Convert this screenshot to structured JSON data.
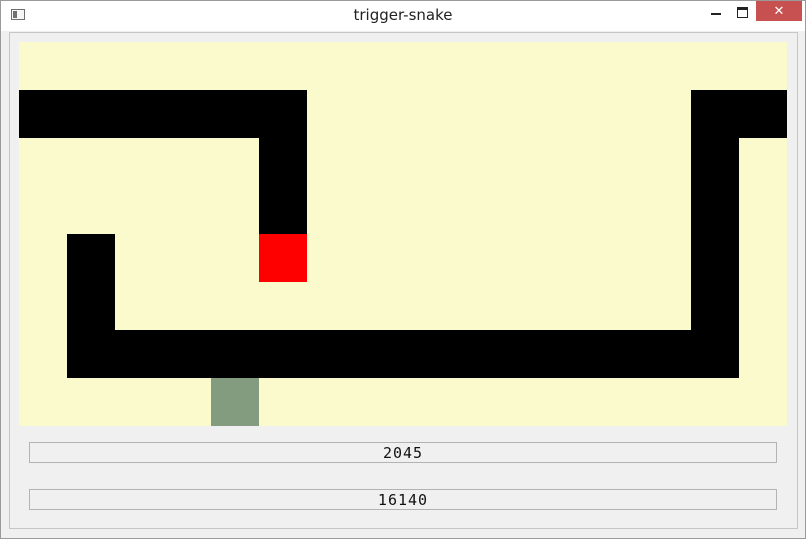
{
  "window": {
    "title": "trigger-snake",
    "close_label": "✕"
  },
  "game": {
    "columns": 16,
    "rows": 8,
    "colors": {
      "background": "#fafacd",
      "snake": "#000000",
      "head": "#ff0000",
      "food": "#839c80"
    },
    "snake_cells": [
      [
        0,
        1
      ],
      [
        1,
        1
      ],
      [
        2,
        1
      ],
      [
        3,
        1
      ],
      [
        4,
        1
      ],
      [
        5,
        1
      ],
      [
        5,
        2
      ],
      [
        5,
        3
      ],
      [
        1,
        4
      ],
      [
        1,
        5
      ],
      [
        2,
        6
      ],
      [
        3,
        6
      ],
      [
        4,
        6
      ],
      [
        5,
        6
      ],
      [
        6,
        6
      ],
      [
        7,
        6
      ],
      [
        8,
        6
      ],
      [
        9,
        6
      ],
      [
        10,
        6
      ],
      [
        11,
        6
      ],
      [
        12,
        6
      ],
      [
        13,
        6
      ],
      [
        14,
        6
      ],
      [
        1,
        6
      ],
      [
        14,
        5
      ],
      [
        14,
        4
      ],
      [
        14,
        3
      ],
      [
        14,
        2
      ],
      [
        14,
        1
      ],
      [
        15,
        1
      ]
    ],
    "head_cell": [
      5,
      4
    ],
    "food_cell": [
      4,
      7
    ]
  },
  "counters": {
    "score": "2045",
    "time": "16140"
  }
}
